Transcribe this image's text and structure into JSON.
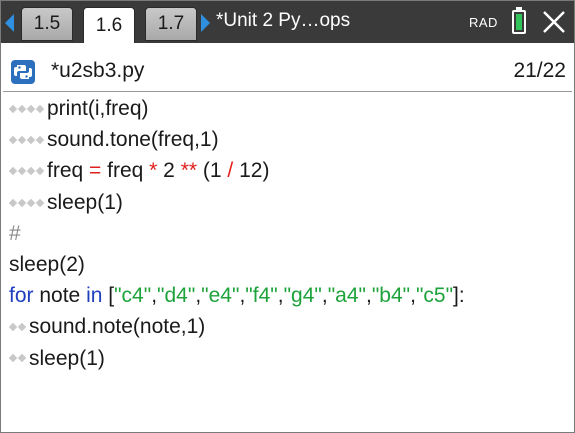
{
  "tabs": [
    {
      "label": "1.5",
      "active": false
    },
    {
      "label": "1.6",
      "active": true
    },
    {
      "label": "1.7",
      "active": false
    }
  ],
  "document_title": "*Unit 2 Py…ops",
  "angle_mode": "RAD",
  "battery_color": "#2fc35a",
  "file": {
    "name": "*u2sb3.py",
    "page": "21/22",
    "icon": "python-icon"
  },
  "code": {
    "line1": {
      "fn": "print(i,freq)"
    },
    "line2": {
      "fn": "sound.tone(freq,1)"
    },
    "line3": {
      "a": "freq ",
      "eq": "=",
      "b": " freq ",
      "mul": "*",
      "c": " 2 ",
      "pow": "**",
      "d": " (1 ",
      "div": "/",
      "e": " 12)"
    },
    "line4": {
      "fn": "sleep(1)"
    },
    "line5": {
      "comment": "#"
    },
    "line6": {
      "fn": "sleep(2)"
    },
    "line7": {
      "kw_for": "for",
      "var": " note ",
      "kw_in": "in",
      "open": " [",
      "s1": "\"c4\"",
      "s2": "\"d4\"",
      "s3": "\"e4\"",
      "s4": "\"f4\"",
      "s5": "\"g4\"",
      "s6": "\"a4\"",
      "s7": "\"b4\"",
      "s8": "\"c5\"",
      "comma": ",",
      "close": "]:"
    },
    "line8": {
      "fn": "sound.note(note,1)"
    },
    "line9": {
      "fn": "sleep(1)"
    }
  },
  "colors": {
    "keyword": "#1f3fbf",
    "string": "#1ea33b",
    "operator": "#e0201c",
    "tab_arrow": "#2f8fe0"
  }
}
